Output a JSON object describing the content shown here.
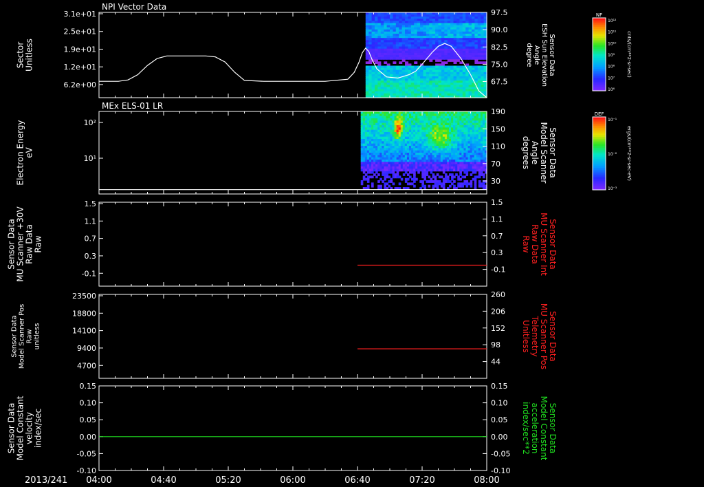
{
  "time_axis": {
    "date": "2013/241",
    "ticks": [
      "04:00",
      "04:40",
      "05:20",
      "06:00",
      "06:40",
      "07:20",
      "08:00"
    ],
    "range": [
      "04:00",
      "08:00"
    ]
  },
  "colorbars": [
    {
      "label": "NF",
      "units": "cnts/(cm**2-sr-sec)",
      "tick_labels": [
        "10¹²",
        "10¹¹",
        "10¹⁰",
        "10⁹",
        "10⁸",
        "10⁷",
        "10⁶"
      ]
    },
    {
      "label": "DEF",
      "units": "ergs/(cm**2-sr-sec-eV)",
      "tick_labels": [
        "10⁻¹",
        "10⁻²",
        "10⁻³"
      ]
    }
  ],
  "chart_data": [
    {
      "type": "line",
      "title": "NPI Vector Data",
      "ylabel_left": [
        "Sector",
        "Unitless"
      ],
      "yticks_left": [
        "3.1e+01",
        "2.5e+01",
        "1.9e+01",
        "1.2e+01",
        "6.2e+00"
      ],
      "ylabel_right": [
        "Sensor Data",
        "ESH Sun Elevation",
        "Angle",
        "degree"
      ],
      "yticks_right": [
        "97.5",
        "90.0",
        "82.5",
        "75.0",
        "67.5"
      ],
      "yticks_right_values": [
        97.5,
        90.0,
        82.5,
        75.0,
        67.5
      ],
      "ylim_right": [
        60.5,
        97.5
      ],
      "spectrogram": {
        "start": "06:45",
        "end": "08:00",
        "colorbar": "NF"
      },
      "series": [
        {
          "axis": "right",
          "color": "#ffffff",
          "x": [
            "04:00",
            "04:12",
            "04:18",
            "04:24",
            "04:30",
            "04:36",
            "04:42",
            "05:06",
            "05:12",
            "05:18",
            "05:24",
            "05:30",
            "05:42",
            "06:00",
            "06:20",
            "06:34",
            "06:38",
            "06:41",
            "06:43",
            "06:45",
            "06:47",
            "06:49",
            "06:52",
            "06:58",
            "07:05",
            "07:12",
            "07:16",
            "07:20",
            "07:26",
            "07:30",
            "07:34",
            "07:38",
            "07:44",
            "07:50",
            "07:55",
            "08:00"
          ],
          "y": [
            67.6,
            67.6,
            68.2,
            70.5,
            74.5,
            77.5,
            78.6,
            78.6,
            78.2,
            76.0,
            71.5,
            68.0,
            67.6,
            67.6,
            67.6,
            68.5,
            71.5,
            76.0,
            80.0,
            82.0,
            80.5,
            77.0,
            73.0,
            69.5,
            69.0,
            70.5,
            72.0,
            75.0,
            80.0,
            82.8,
            84.0,
            82.8,
            77.5,
            70.5,
            63.5,
            60.5
          ]
        }
      ]
    },
    {
      "type": "heatmap",
      "title": "MEx ELS-01 LR",
      "ylabel_left": [
        "Electron Energy",
        "eV"
      ],
      "yticks_left": [
        "10²",
        "10¹"
      ],
      "ylabel_right": [
        "Sensor Data",
        "Model Scanner",
        "Angle",
        "degrees"
      ],
      "yticks_right": [
        "190",
        "150",
        "110",
        "70",
        "30"
      ],
      "yticks_right_values": [
        190,
        150,
        110,
        70,
        30
      ],
      "ylim_right": [
        0,
        190
      ],
      "spectrogram": {
        "start": "06:42",
        "end": "08:00",
        "colorbar": "DEF"
      },
      "series": [
        {
          "axis": "right",
          "color": "#ffffff",
          "x": [
            "04:00",
            "08:00"
          ],
          "y": [
            10,
            10
          ]
        }
      ]
    },
    {
      "type": "line",
      "ylabel_left": [
        "Sensor Data",
        "MU Scanner +30V",
        "Raw Data",
        "Raw"
      ],
      "yticks_left": [
        "1.5",
        "1.1",
        "0.7",
        "0.3",
        "-0.1"
      ],
      "yticks_left_values": [
        1.5,
        1.1,
        0.7,
        0.3,
        -0.1
      ],
      "ylabel_right": [
        "Sensor Data",
        "MU Scanner Int",
        "Raw Data",
        "Raw"
      ],
      "ylabel_right_color": "#ff2020",
      "yticks_right": [
        "1.5",
        "1.1",
        "0.7",
        "0.3",
        "-0.1"
      ],
      "yticks_right_values": [
        1.5,
        1.1,
        0.7,
        0.3,
        -0.1
      ],
      "ylim_right": [
        -0.5,
        1.5
      ],
      "series": [
        {
          "axis": "right",
          "color": "#ff2020",
          "x": [
            "06:40",
            "08:00"
          ],
          "y": [
            0.0,
            0.0
          ]
        }
      ]
    },
    {
      "type": "line",
      "ylabel_left": [
        "Sensor Data",
        "Model Scanner Pos",
        "Raw",
        "unitless"
      ],
      "yticks_left": [
        "23500",
        "18800",
        "14100",
        "9400",
        "4700"
      ],
      "yticks_left_values": [
        23500,
        18800,
        14100,
        9400,
        4700
      ],
      "ylabel_right": [
        "Sensor Data",
        "MU Scanner Pos",
        "Telemetry",
        "Unitless"
      ],
      "ylabel_right_color": "#ff2020",
      "yticks_right": [
        "260",
        "206",
        "152",
        "98",
        "44"
      ],
      "yticks_right_values": [
        260,
        206,
        152,
        98,
        44
      ],
      "ylim_right": [
        -10,
        260
      ],
      "series": [
        {
          "axis": "right",
          "color": "#ff2020",
          "x": [
            "06:40",
            "08:00"
          ],
          "y": [
            85,
            85
          ]
        }
      ]
    },
    {
      "type": "line",
      "ylabel_left": [
        "Sensor Data",
        "Model Constant",
        "velocity",
        "index/sec"
      ],
      "yticks_left": [
        "0.15",
        "0.10",
        "0.05",
        "0.00",
        "-0.05",
        "-0.10"
      ],
      "yticks_left_values": [
        0.15,
        0.1,
        0.05,
        0.0,
        -0.05,
        -0.1
      ],
      "ylabel_right": [
        "Sensor Data",
        "Model Constant",
        "acceleration",
        "index/sec**2"
      ],
      "ylabel_right_color": "#20e020",
      "yticks_right": [
        "0.15",
        "0.10",
        "0.05",
        "0.00",
        "-0.05",
        "-0.10"
      ],
      "yticks_right_values": [
        0.15,
        0.1,
        0.05,
        0.0,
        -0.05,
        -0.1
      ],
      "ylim_right": [
        -0.1,
        0.15
      ],
      "series": [
        {
          "axis": "right",
          "color": "#20e020",
          "x": [
            "04:00",
            "08:00"
          ],
          "y": [
            0.0,
            0.0
          ]
        }
      ]
    }
  ]
}
